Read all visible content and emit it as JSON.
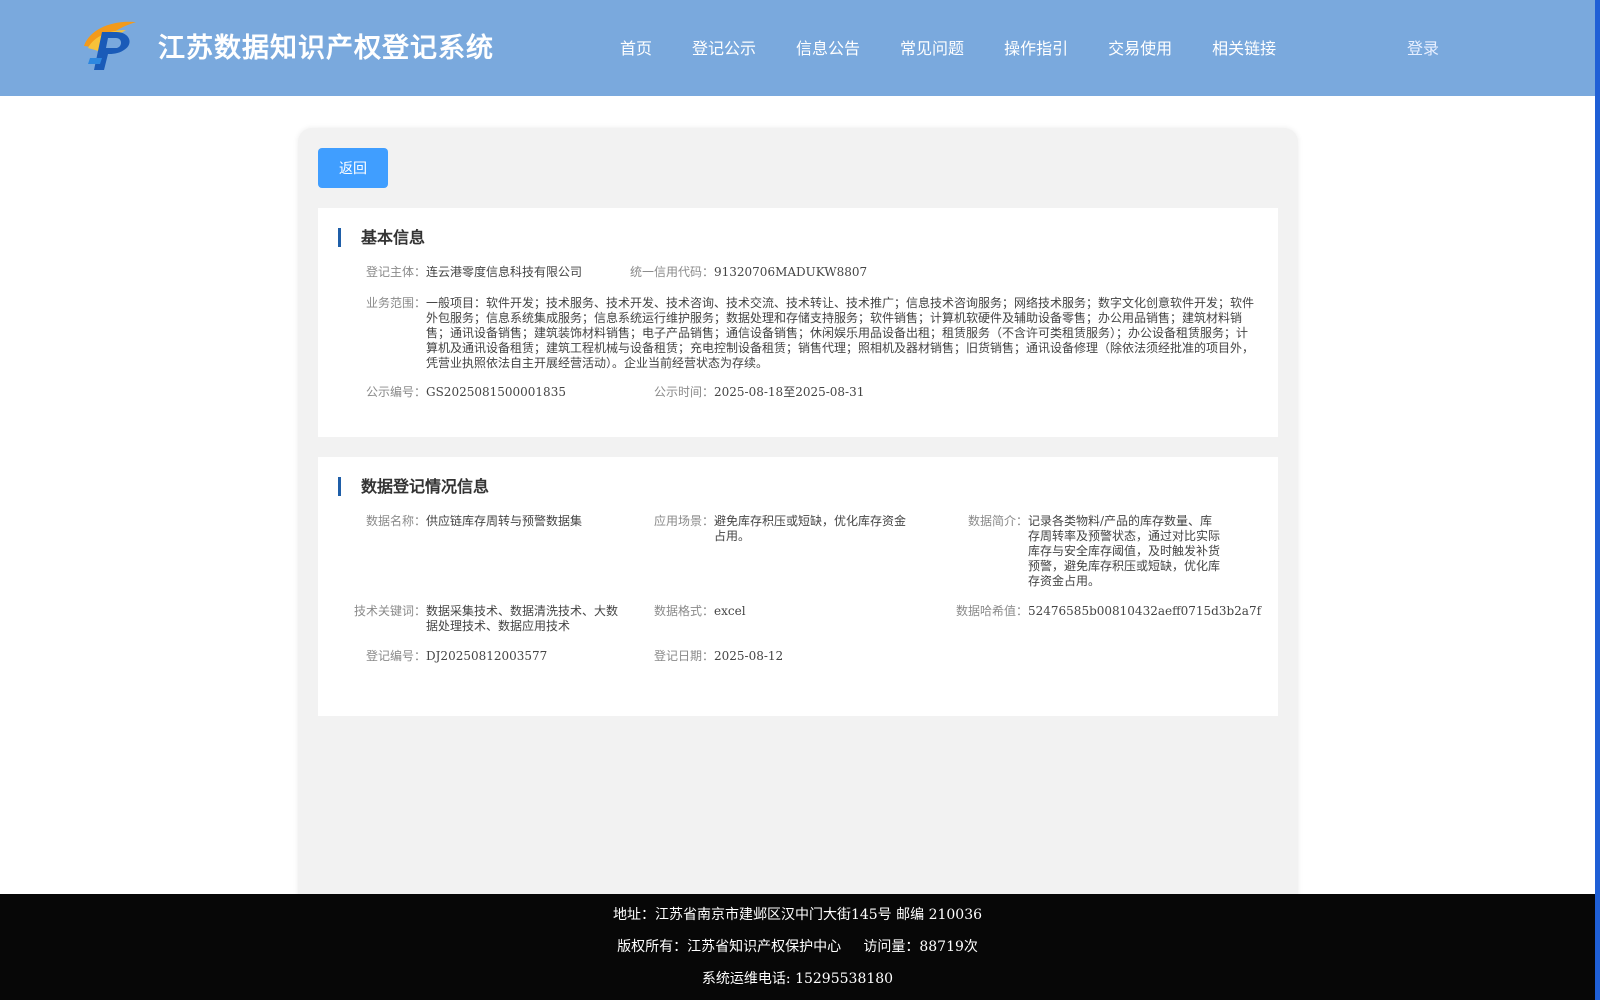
{
  "header": {
    "title": "江苏数据知识产权登记系统",
    "nav": [
      "首页",
      "登记公示",
      "信息公告",
      "常见问题",
      "操作指引",
      "交易使用",
      "相关链接"
    ],
    "login": "登录"
  },
  "back_button": "返回",
  "basic_info": {
    "title": "基本信息",
    "entity_label": "登记主体：",
    "entity_value": "连云港零度信息科技有限公司",
    "credit_label": "统一信用代码：",
    "credit_value": "91320706MADUKW8807",
    "scope_label": "业务范围：",
    "scope_value": "一般项目：软件开发；技术服务、技术开发、技术咨询、技术交流、技术转让、技术推广；信息技术咨询服务；网络技术服务；数字文化创意软件开发；软件外包服务；信息系统集成服务；信息系统运行维护服务；数据处理和存储支持服务；软件销售；计算机软硬件及辅助设备零售；办公用品销售；建筑材料销售；通讯设备销售；建筑装饰材料销售；电子产品销售；通信设备销售；休闲娱乐用品设备出租；租赁服务（不含许可类租赁服务）；办公设备租赁服务；计算机及通讯设备租赁；建筑工程机械与设备租赁；充电控制设备租赁；销售代理；照相机及器材销售；旧货销售；通讯设备修理（除依法须经批准的项目外，凭营业执照依法自主开展经营活动）。企业当前经营状态为存续。",
    "pub_no_label": "公示编号：",
    "pub_no_value": "GS2025081500001835",
    "pub_time_label": "公示时间：",
    "pub_time_value": "2025-08-18至2025-08-31"
  },
  "data_info": {
    "title": "数据登记情况信息",
    "name_label": "数据名称：",
    "name_value": "供应链库存周转与预警数据集",
    "scene_label": "应用场景：",
    "scene_value": "避免库存积压或短缺，优化库存资金占用。",
    "intro_label": "数据简介：",
    "intro_value": "记录各类物料/产品的库存数量、库存周转率及预警状态，通过对比实际库存与安全库存阈值，及时触发补货预警，避免库存积压或短缺，优化库存资金占用。",
    "tech_label": "技术关键词：",
    "tech_value": "数据采集技术、数据清洗技术、大数据处理技术、数据应用技术",
    "format_label": "数据格式：",
    "format_value": "excel",
    "hash_label": "数据哈希值：",
    "hash_value": "52476585b00810432aeff0715d3b2a7f",
    "reg_no_label": "登记编号：",
    "reg_no_value": "DJ20250812003577",
    "reg_date_label": "登记日期：",
    "reg_date_value": "2025-08-12"
  },
  "footer": {
    "address": "地址：江苏省南京市建邺区汉中门大街145号 邮编 210036",
    "copyright": "版权所有：江苏省知识产权保护中心     访问量：88719次",
    "phone": "系统运维电话: 15295538180"
  }
}
